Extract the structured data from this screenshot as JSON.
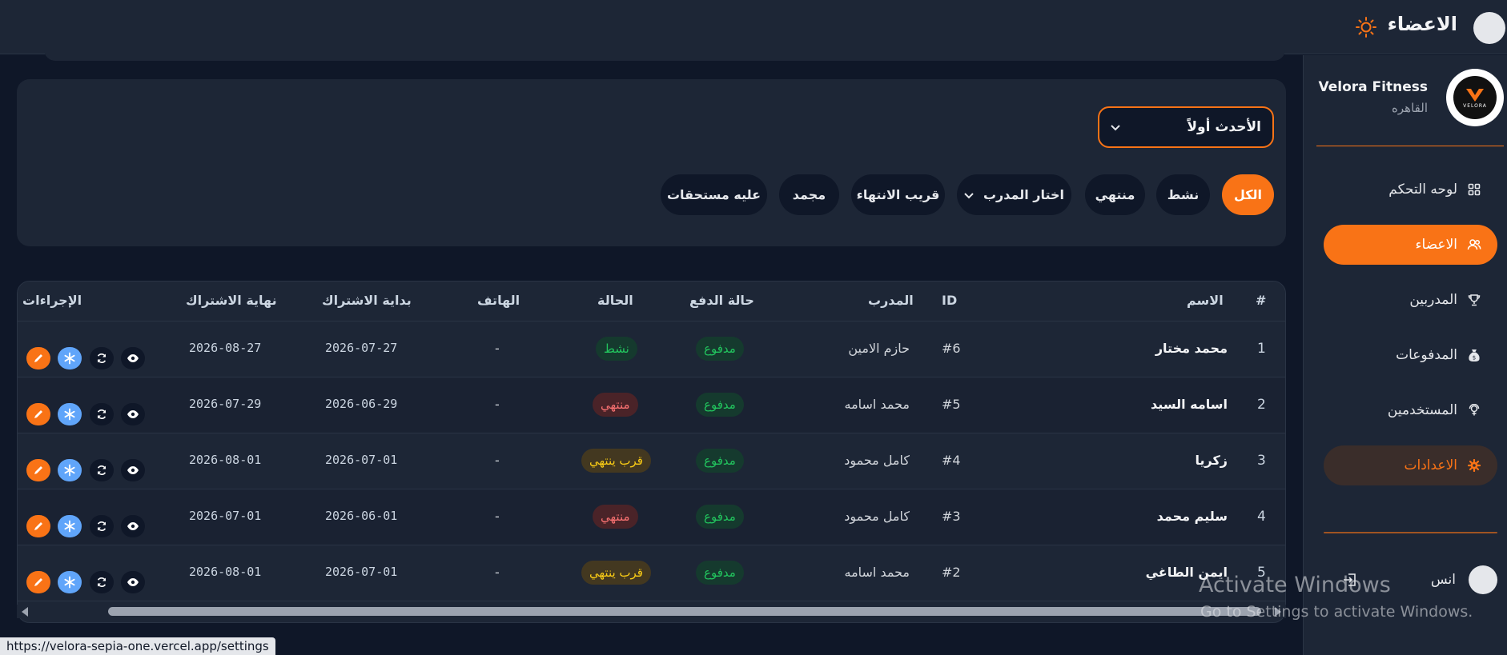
{
  "header": {
    "title": "الاعضاء",
    "theme_icon": "sun-icon"
  },
  "sidebar": {
    "brand_name": "Velora Fitness",
    "brand_city": "القاهره",
    "logo_text": "VELORA",
    "items": [
      {
        "label": "لوحه التحكم",
        "icon": "dashboard-grid-icon"
      },
      {
        "label": "الاعضاء",
        "icon": "users-icon",
        "active": true
      },
      {
        "label": "المدربين",
        "icon": "trophy-icon"
      },
      {
        "label": "المدفوعات",
        "icon": "money-bag-icon"
      },
      {
        "label": "المستخدمين",
        "icon": "user-access-icon"
      },
      {
        "label": "الاعدادات",
        "icon": "gear-icon",
        "highlight": true
      }
    ],
    "user_name": "انس"
  },
  "filters": {
    "sort_value": "الأحدث أولاً",
    "chips": {
      "all": "الكل",
      "active": "نشط",
      "ended": "منتهي",
      "coach": "اختار المدرب",
      "ending_soon": "قريب الانتهاء",
      "frozen": "مجمد",
      "dues": "عليه مستحقات"
    }
  },
  "table": {
    "headers": {
      "index": "#",
      "name": "الاسم",
      "id": "ID",
      "coach": "المدرب",
      "payment": "حالة الدفع",
      "status": "الحالة",
      "phone": "الهاتف",
      "start": "بداية الاشتراك",
      "end": "نهاية الاشتراك",
      "actions": "الإجراءات"
    },
    "rows": [
      {
        "index": "1",
        "name": "محمد مختار",
        "id": "#6",
        "coach": "حازم الامين",
        "payment": "مدفوع",
        "status": "نشط",
        "phone": "-",
        "start": "2026-07-27",
        "end": "2026-08-27"
      },
      {
        "index": "2",
        "name": "اسامه السيد",
        "id": "#5",
        "coach": "محمد اسامه",
        "payment": "مدفوع",
        "status": "منتهي",
        "phone": "-",
        "start": "2026-06-29",
        "end": "2026-07-29"
      },
      {
        "index": "3",
        "name": "زكريا",
        "id": "#4",
        "coach": "كامل محمود",
        "payment": "مدفوع",
        "status": "قرب ينتهي",
        "phone": "-",
        "start": "2026-07-01",
        "end": "2026-08-01"
      },
      {
        "index": "4",
        "name": "سليم محمد",
        "id": "#3",
        "coach": "كامل محمود",
        "payment": "مدفوع",
        "status": "منتهي",
        "phone": "-",
        "start": "2026-06-01",
        "end": "2026-07-01"
      },
      {
        "index": "5",
        "name": "ايمن الطاغي",
        "id": "#2",
        "coach": "محمد اسامه",
        "payment": "مدفوع",
        "status": "قرب ينتهي",
        "phone": "-",
        "start": "2026-07-01",
        "end": "2026-08-01"
      }
    ]
  },
  "status_bar": {
    "url": "https://velora-sepia-one.vercel.app/settings"
  },
  "watermark": {
    "line1": "Activate Windows",
    "line2": "Go to Settings to activate Windows."
  },
  "colors": {
    "accent": "#f97316",
    "bg": "#0f1728",
    "panel": "#1d2636",
    "paid": "#22c55e",
    "ended": "#f87171",
    "soon": "#facc15"
  }
}
